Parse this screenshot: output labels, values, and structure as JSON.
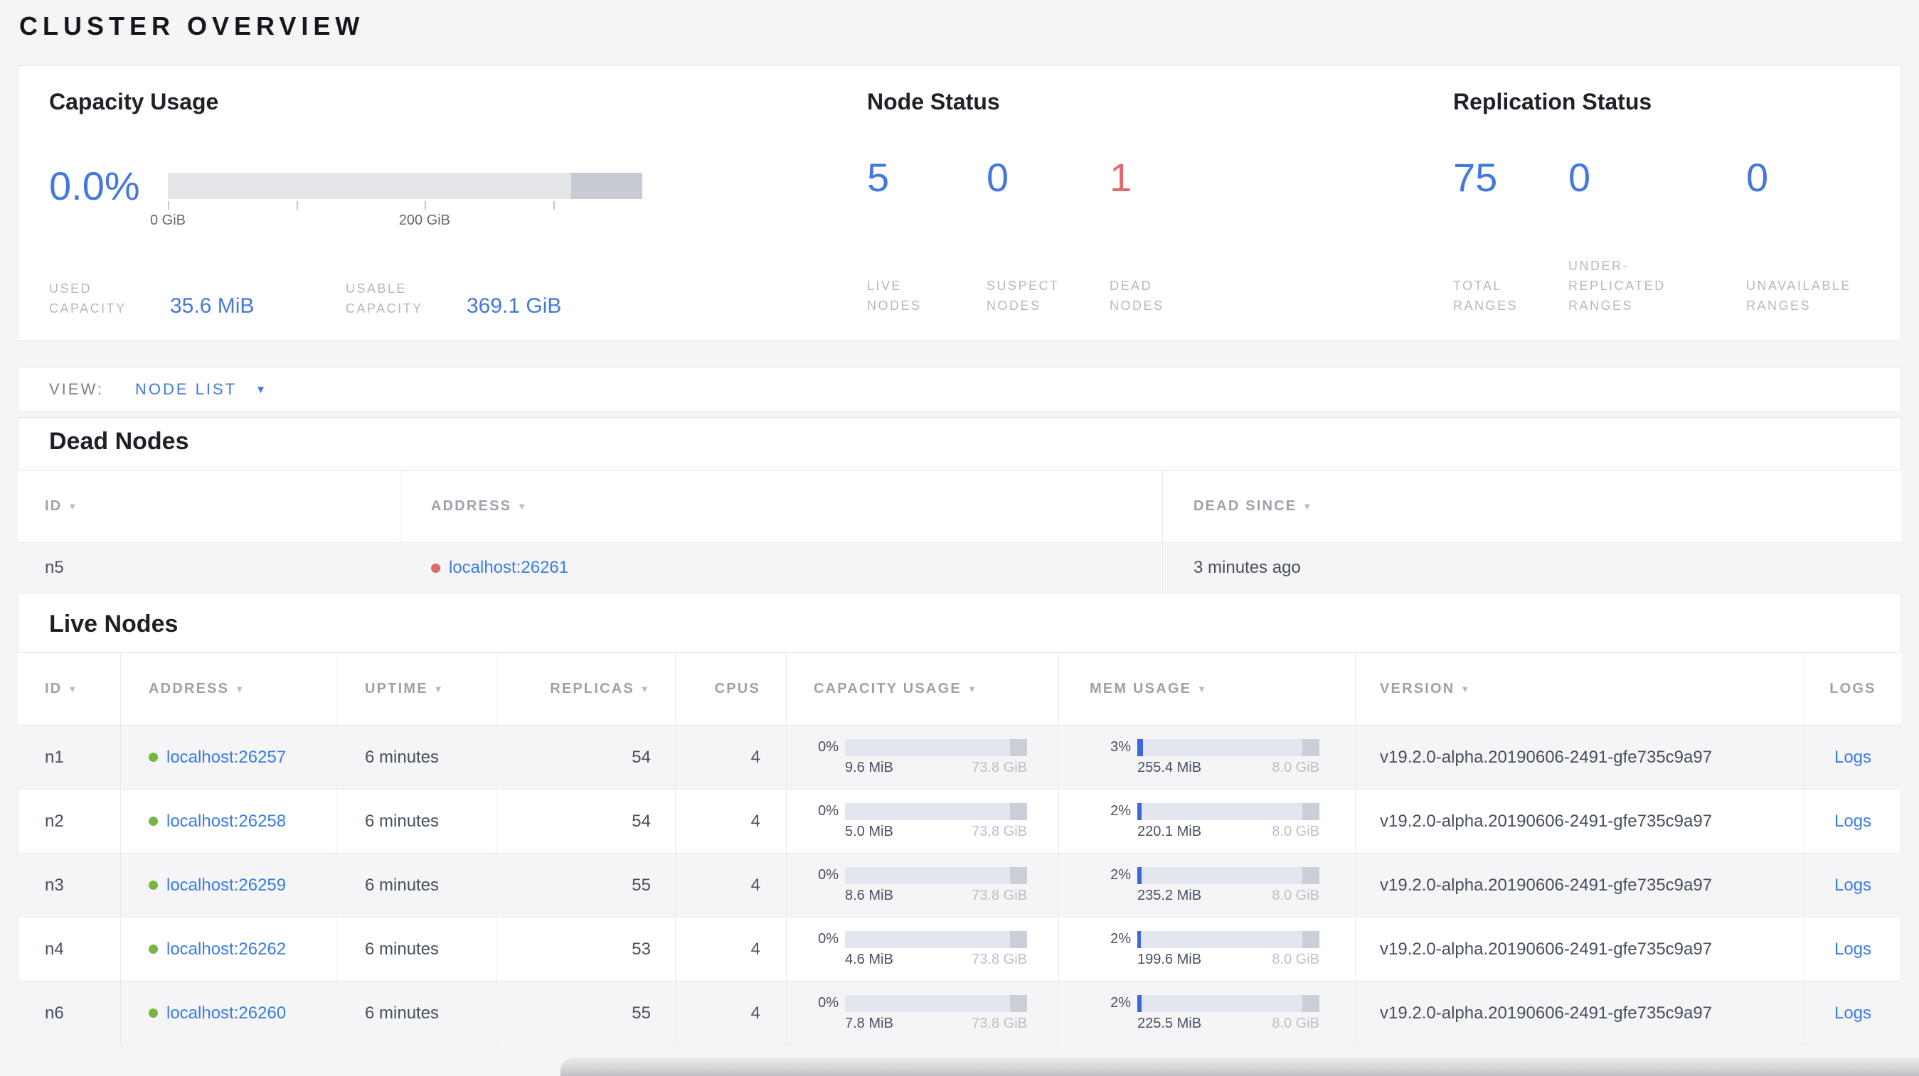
{
  "colors": {
    "accent_blue": "#4478dd",
    "link_blue": "#3b7ce2",
    "danger_red": "#e0696d",
    "live_green": "#77b643"
  },
  "page_title": "CLUSTER OVERVIEW",
  "summary": {
    "capacity": {
      "title": "Capacity Usage",
      "percent": "0.0%",
      "axis_tick_0": "0 GiB",
      "axis_tick_200": "200 GiB",
      "stats": [
        {
          "label": "USED\nCAPACITY",
          "value": "35.6 MiB"
        },
        {
          "label": "USABLE\nCAPACITY",
          "value": "369.1 GiB"
        }
      ]
    },
    "node_status": {
      "title": "Node Status",
      "stats": [
        {
          "value": "5",
          "label": "LIVE\nNODES"
        },
        {
          "value": "0",
          "label": "SUSPECT\nNODES"
        },
        {
          "value": "1",
          "label": "DEAD\nNODES"
        }
      ]
    },
    "replication_status": {
      "title": "Replication Status",
      "stats": [
        {
          "value": "75",
          "label": "TOTAL\nRANGES"
        },
        {
          "value": "0",
          "label": "UNDER-\nREPLICATED\nRANGES"
        },
        {
          "value": "0",
          "label": "UNAVAILABLE\nRANGES"
        }
      ]
    }
  },
  "view_bar": {
    "label": "VIEW:",
    "selected": "NODE LIST",
    "caret": "▼"
  },
  "dead_nodes": {
    "heading": "Dead Nodes",
    "columns": [
      {
        "label": "ID",
        "caret": "▼"
      },
      {
        "label": "ADDRESS",
        "caret": "▼"
      },
      {
        "label": "DEAD SINCE",
        "caret": "▼"
      }
    ],
    "rows": [
      {
        "id": "n5",
        "address": "localhost:26261",
        "dead_since": "3 minutes ago"
      }
    ]
  },
  "live_nodes": {
    "heading": "Live Nodes",
    "columns": [
      {
        "label": "ID",
        "caret": "▼"
      },
      {
        "label": "ADDRESS",
        "caret": "▼"
      },
      {
        "label": "UPTIME",
        "caret": "▼"
      },
      {
        "label": "REPLICAS",
        "caret": "▼"
      },
      {
        "label": "CPUS",
        "caret": ""
      },
      {
        "label": "CAPACITY USAGE",
        "caret": "▼"
      },
      {
        "label": "MEM USAGE",
        "caret": "▼"
      },
      {
        "label": "VERSION",
        "caret": "▼"
      },
      {
        "label": "LOGS",
        "caret": ""
      }
    ],
    "rows": [
      {
        "id": "n1",
        "address": "localhost:26257",
        "uptime": "6 minutes",
        "replicas": "54",
        "cpus": "4",
        "capacity": {
          "percent": "0%",
          "fill": 0,
          "used": "9.6 MiB",
          "total": "73.8 GiB"
        },
        "memory": {
          "percent": "3%",
          "fill": 3,
          "used": "255.4 MiB",
          "total": "8.0 GiB"
        },
        "version": "v19.2.0-alpha.20190606-2491-gfe735c9a97",
        "logs_label": "Logs"
      },
      {
        "id": "n2",
        "address": "localhost:26258",
        "uptime": "6 minutes",
        "replicas": "54",
        "cpus": "4",
        "capacity": {
          "percent": "0%",
          "fill": 0,
          "used": "5.0 MiB",
          "total": "73.8 GiB"
        },
        "memory": {
          "percent": "2%",
          "fill": 2.2,
          "used": "220.1 MiB",
          "total": "8.0 GiB"
        },
        "version": "v19.2.0-alpha.20190606-2491-gfe735c9a97",
        "logs_label": "Logs"
      },
      {
        "id": "n3",
        "address": "localhost:26259",
        "uptime": "6 minutes",
        "replicas": "55",
        "cpus": "4",
        "capacity": {
          "percent": "0%",
          "fill": 0,
          "used": "8.6 MiB",
          "total": "73.8 GiB"
        },
        "memory": {
          "percent": "2%",
          "fill": 2.4,
          "used": "235.2 MiB",
          "total": "8.0 GiB"
        },
        "version": "v19.2.0-alpha.20190606-2491-gfe735c9a97",
        "logs_label": "Logs"
      },
      {
        "id": "n4",
        "address": "localhost:26262",
        "uptime": "6 minutes",
        "replicas": "53",
        "cpus": "4",
        "capacity": {
          "percent": "0%",
          "fill": 0,
          "used": "4.6 MiB",
          "total": "73.8 GiB"
        },
        "memory": {
          "percent": "2%",
          "fill": 2,
          "used": "199.6 MiB",
          "total": "8.0 GiB"
        },
        "version": "v19.2.0-alpha.20190606-2491-gfe735c9a97",
        "logs_label": "Logs"
      },
      {
        "id": "n6",
        "address": "localhost:26260",
        "uptime": "6 minutes",
        "replicas": "55",
        "cpus": "4",
        "capacity": {
          "percent": "0%",
          "fill": 0,
          "used": "7.8 MiB",
          "total": "73.8 GiB"
        },
        "memory": {
          "percent": "2%",
          "fill": 2.3,
          "used": "225.5 MiB",
          "total": "8.0 GiB"
        },
        "version": "v19.2.0-alpha.20190606-2491-gfe735c9a97",
        "logs_label": "Logs"
      }
    ]
  }
}
